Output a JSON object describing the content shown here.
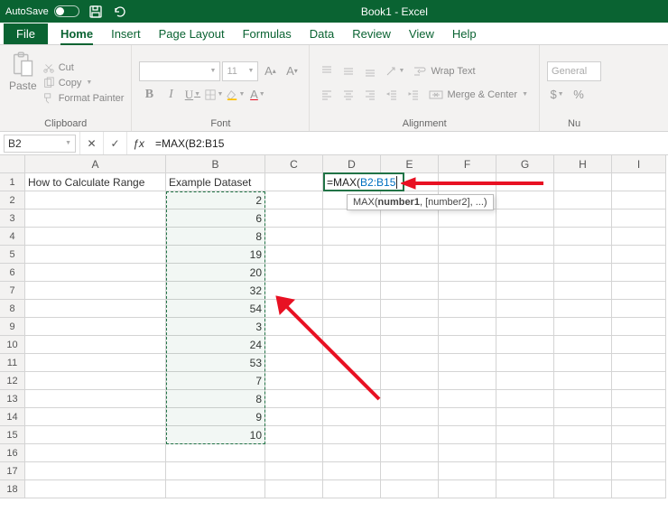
{
  "titlebar": {
    "autosave_label": "AutoSave",
    "book_title": "Book1 - Excel"
  },
  "tabs": {
    "file": "File",
    "home": "Home",
    "insert": "Insert",
    "page_layout": "Page Layout",
    "formulas": "Formulas",
    "data": "Data",
    "review": "Review",
    "view": "View",
    "help": "Help"
  },
  "ribbon": {
    "clipboard": {
      "paste": "Paste",
      "cut": "Cut",
      "copy": "Copy",
      "format_painter": "Format Painter",
      "group": "Clipboard"
    },
    "font": {
      "font_name": "",
      "font_size": "11",
      "group": "Font"
    },
    "alignment": {
      "wrap": "Wrap Text",
      "merge": "Merge & Center",
      "group": "Alignment"
    },
    "number": {
      "format": "General",
      "group": "Nu"
    }
  },
  "formula_bar": {
    "name_box": "B2",
    "formula_text": "=MAX(B2:B15"
  },
  "grid": {
    "columns": [
      "A",
      "B",
      "C",
      "D",
      "E",
      "F",
      "G",
      "H",
      "I"
    ],
    "row_count": 18,
    "headers": {
      "A1": "How to Calculate Range",
      "B1": "Example Dataset"
    },
    "data_b": [
      2,
      6,
      8,
      19,
      20,
      32,
      54,
      3,
      24,
      53,
      7,
      8,
      9,
      10
    ]
  },
  "editing": {
    "cell_ref": "D1",
    "prefix": "=MAX(",
    "range_ref": "B2:B15",
    "tooltip_fn": "MAX(",
    "tooltip_arg1": "number1",
    "tooltip_rest": ", [number2], ...)"
  },
  "chart_data": {
    "type": "table",
    "title": "Example Dataset",
    "series": [
      {
        "name": "Example Dataset",
        "values": [
          2,
          6,
          8,
          19,
          20,
          32,
          54,
          3,
          24,
          53,
          7,
          8,
          9,
          10
        ]
      }
    ],
    "annotation": "Formula being entered: =MAX(B2:B15"
  }
}
